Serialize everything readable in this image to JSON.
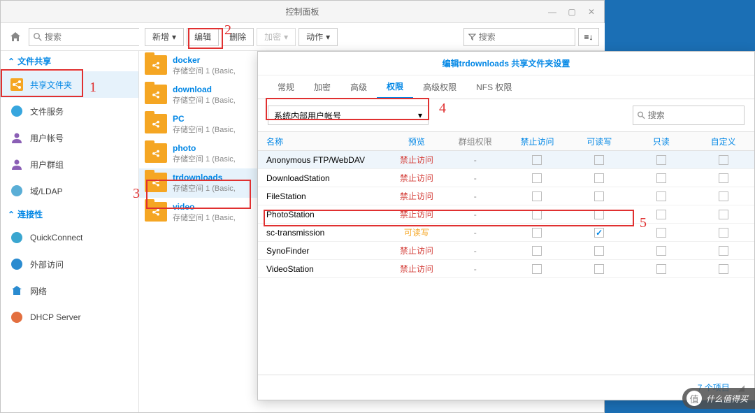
{
  "window": {
    "title": "控制面板"
  },
  "search": {
    "placeholder": "搜索"
  },
  "toolbar": {
    "new": "新增",
    "edit": "编辑",
    "delete": "删除",
    "encrypt": "加密",
    "action": "动作",
    "filter_placeholder": "搜索"
  },
  "sidebar": {
    "header": "文件共享",
    "items": [
      {
        "label": "共享文件夹",
        "active": true,
        "icon": "share"
      },
      {
        "label": "文件服务",
        "icon": "fileservice"
      },
      {
        "label": "用户帐号",
        "icon": "user"
      },
      {
        "label": "用户群组",
        "icon": "group"
      },
      {
        "label": "域/LDAP",
        "icon": "ldap"
      }
    ],
    "header2": "连接性",
    "items2": [
      {
        "label": "QuickConnect",
        "icon": "qc"
      },
      {
        "label": "外部访问",
        "icon": "ext"
      },
      {
        "label": "网络",
        "icon": "net"
      },
      {
        "label": "DHCP Server",
        "icon": "dhcp"
      }
    ]
  },
  "folders": [
    {
      "name": "docker",
      "desc": "存储空间 1 (Basic,"
    },
    {
      "name": "download",
      "desc": "存储空间 1 (Basic,"
    },
    {
      "name": "PC",
      "desc": "存储空间 1 (Basic,"
    },
    {
      "name": "photo",
      "desc": "存储空间 1 (Basic,"
    },
    {
      "name": "trdownloads",
      "desc": "存储空间 1 (Basic,",
      "active": true
    },
    {
      "name": "video",
      "desc": "存储空间 1 (Basic,"
    }
  ],
  "dialog": {
    "title": "编辑trdownloads 共享文件夹设置",
    "tabs": [
      "常规",
      "加密",
      "高级",
      "权限",
      "高级权限",
      "NFS 权限"
    ],
    "active_tab": 3,
    "select_label": "系统内部用户帐号",
    "search_placeholder": "搜索",
    "columns": {
      "name": "名称",
      "preview": "预览",
      "group": "群组权限",
      "na": "禁止访问",
      "rw": "可读写",
      "ro": "只读",
      "custom": "自定义"
    },
    "deny_text": "禁止访问",
    "allow_text": "可读写",
    "rows": [
      {
        "name": "Anonymous FTP/WebDAV",
        "preview": "deny",
        "group": "-",
        "rw": false,
        "sel": true
      },
      {
        "name": "DownloadStation",
        "preview": "deny",
        "group": "-",
        "rw": false
      },
      {
        "name": "FileStation",
        "preview": "deny",
        "group": "-",
        "rw": false
      },
      {
        "name": "PhotoStation",
        "preview": "deny",
        "group": "-",
        "rw": false
      },
      {
        "name": "sc-transmission",
        "preview": "allow",
        "group": "-",
        "rw": true
      },
      {
        "name": "SynoFinder",
        "preview": "deny",
        "group": "-",
        "rw": false
      },
      {
        "name": "VideoStation",
        "preview": "deny",
        "group": "-",
        "rw": false
      }
    ],
    "footer": "7 个项目"
  },
  "annotations": [
    "1",
    "2",
    "3",
    "4",
    "5"
  ],
  "watermark": {
    "logo": "值",
    "text": "什么值得买"
  }
}
